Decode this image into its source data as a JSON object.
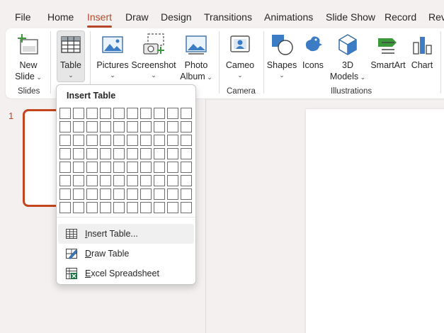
{
  "menu_tabs": [
    "File",
    "Home",
    "Insert",
    "Draw",
    "Design",
    "Transitions",
    "Animations",
    "Slide Show",
    "Record",
    "Rev"
  ],
  "active_tab": "Insert",
  "accent_color": "#b7472a",
  "ribbon": {
    "slides": {
      "new_slide_line1": "New",
      "new_slide_line2": "Slide",
      "group_label": "Slides"
    },
    "tables": {
      "table_label": "Table"
    },
    "images": {
      "pictures": "Pictures",
      "screenshot": "Screenshot",
      "photo_album_line1": "Photo",
      "photo_album_line2": "Album"
    },
    "camera": {
      "cameo": "Cameo",
      "group_label": "Camera"
    },
    "illustrations": {
      "shapes": "Shapes",
      "icons": "Icons",
      "models_line1": "3D",
      "models_line2": "Models",
      "smartart": "SmartArt",
      "chart": "Chart",
      "group_label": "Illustrations"
    }
  },
  "slide_panel": {
    "slide_number": "1"
  },
  "dropdown": {
    "title": "Insert Table",
    "grid_rows": 8,
    "grid_cols": 10,
    "items": {
      "insert_table": {
        "label_rest": "nsert Table...",
        "label_u": "I"
      },
      "draw_table": {
        "label_rest": "raw Table",
        "label_u": "D"
      },
      "excel": {
        "label_rest": "xcel Spreadsheet",
        "label_u": "E"
      }
    }
  }
}
